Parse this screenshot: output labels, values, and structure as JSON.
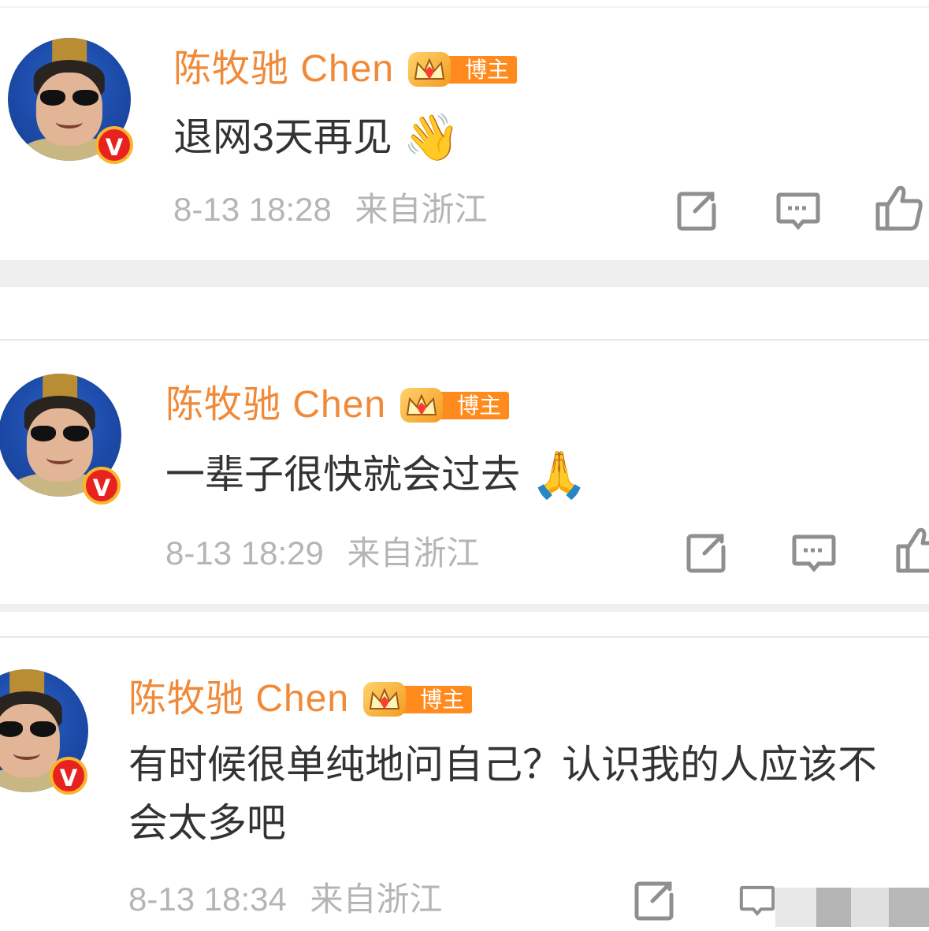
{
  "colors": {
    "username": "#f08a39",
    "text": "#333333",
    "meta": "#b5b5b5",
    "verified": "#e8221f",
    "badge_bg": "#ff8b1f"
  },
  "icons": {
    "share": "share-icon",
    "comment": "comment-icon",
    "like": "thumbs-up-icon"
  },
  "posts": [
    {
      "username": "陈牧驰 Chen",
      "badge_label": "博主",
      "verified_mark": "V",
      "content": "退网3天再见",
      "emoji": "👋",
      "date": "8-13 18:28",
      "location": "来自浙江"
    },
    {
      "username": "陈牧驰 Chen",
      "badge_label": "博主",
      "verified_mark": "V",
      "content": "一辈子很快就会过去",
      "emoji": "🙏",
      "date": "8-13 18:29",
      "location": "来自浙江"
    },
    {
      "username": "陈牧驰 Chen",
      "badge_label": "博主",
      "verified_mark": "V",
      "content": "有时候很单纯地问自己？认识我的人应该不",
      "content_line2": "会太多吧",
      "date": "8-13 18:34",
      "location": "来自浙江"
    }
  ]
}
